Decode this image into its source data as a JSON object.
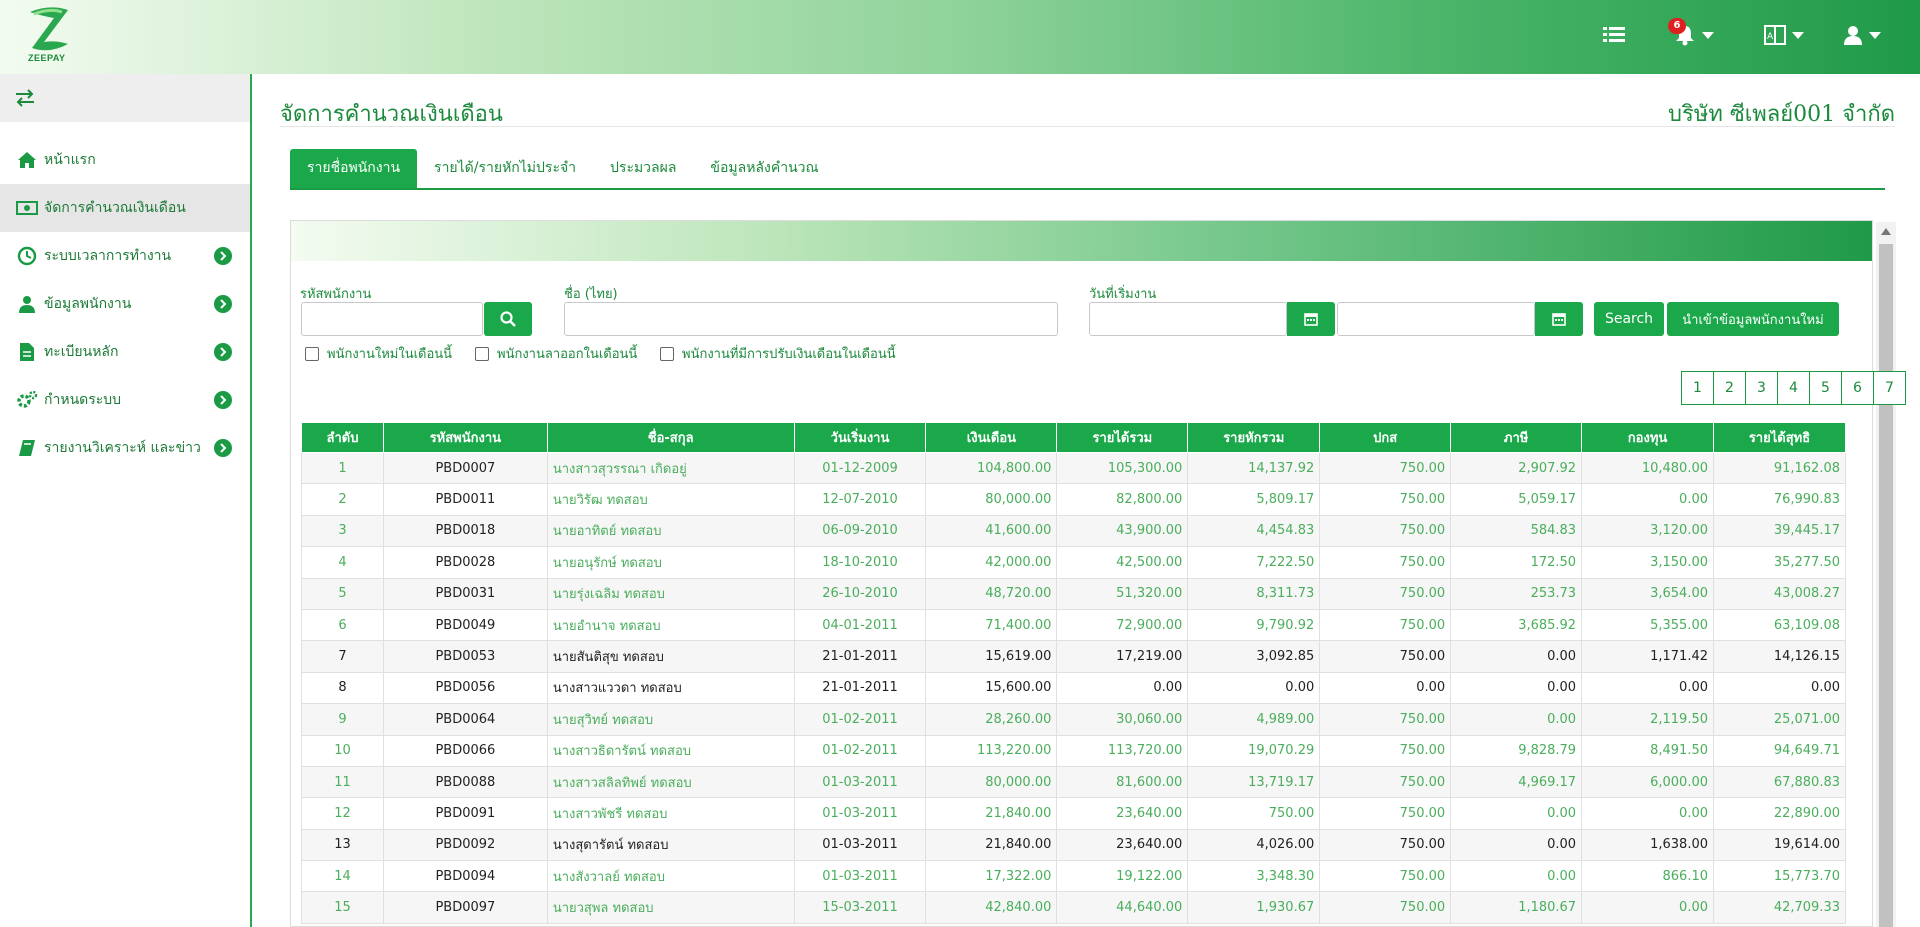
{
  "header": {
    "logo_text": "ZEEPAY",
    "notification_count": "6",
    "icons": [
      "list-icon",
      "bell-icon",
      "language-icon",
      "user-icon"
    ]
  },
  "sidebar": {
    "items": [
      {
        "label": "หน้าแรก",
        "icon": "home-icon",
        "has_arrow": false
      },
      {
        "label": "จัดการคำนวณเงินเดือน",
        "icon": "money-icon",
        "has_arrow": false,
        "active": true
      },
      {
        "label": "ระบบเวลาการทำงาน",
        "icon": "clock-icon",
        "has_arrow": true
      },
      {
        "label": "ข้อมูลพนักงาน",
        "icon": "user-icon",
        "has_arrow": true
      },
      {
        "label": "ทะเบียนหลัก",
        "icon": "file-icon",
        "has_arrow": true
      },
      {
        "label": "กำหนดระบบ",
        "icon": "gears-icon",
        "has_arrow": true
      },
      {
        "label": "รายงานวิเคราะห์ และข่าว",
        "icon": "book-icon",
        "has_arrow": true
      }
    ]
  },
  "page": {
    "title": "จัดการคำนวณเงินเดือน",
    "company": "บริษัท ซีเพลย์001 จำกัด"
  },
  "tabs": [
    {
      "label": "รายชื่อพนักงาน",
      "active": true
    },
    {
      "label": "รายได้/รายหักไม่ประจำ"
    },
    {
      "label": "ประมวลผล"
    },
    {
      "label": "ข้อมูลหลังคำนวณ"
    }
  ],
  "filters": {
    "emp_code_label": "รหัสพนักงาน",
    "emp_code_value": "",
    "name_label": "ชื่อ (ไทย)",
    "name_value": "",
    "start_date_label": "วันที่เริ่มงาน",
    "date_from": "",
    "date_to": "",
    "search_button": "Search",
    "import_button": "นำเข้าข้อมูลพนักงานใหม่",
    "check_new": "พนักงานใหม่ในเดือนนี้",
    "check_resigned": "พนักงานลาออกในเดือนนี้",
    "check_adjusted": "พนักงานที่มีการปรับเงินเดือนในเดือนนี้"
  },
  "pagination": [
    "1",
    "2",
    "3",
    "4",
    "5",
    "6",
    "7"
  ],
  "table": {
    "columns": [
      "ลำดับ",
      "รหัสพนักงาน",
      "ชื่อ-สกุล",
      "วันเริ่มงาน",
      "เงินเดือน",
      "รายได้รวม",
      "รายหักรวม",
      "ปกส",
      "ภาษี",
      "กองทุน",
      "รายได้สุทธิ"
    ],
    "rows": [
      {
        "no": "1",
        "code": "PBD0007",
        "name": "นางสาวสุวรรณา เกิดอยู่",
        "start": "01-12-2009",
        "salary": "104,800.00",
        "income": "105,300.00",
        "deduct": "14,137.92",
        "sso": "750.00",
        "tax": "2,907.92",
        "fund": "10,480.00",
        "net": "91,162.08",
        "style": "g"
      },
      {
        "no": "2",
        "code": "PBD0011",
        "name": "นายวิรัฒ ทดสอบ",
        "start": "12-07-2010",
        "salary": "80,000.00",
        "income": "82,800.00",
        "deduct": "5,809.17",
        "sso": "750.00",
        "tax": "5,059.17",
        "fund": "0.00",
        "net": "76,990.83",
        "style": "g"
      },
      {
        "no": "3",
        "code": "PBD0018",
        "name": "นายอาทิตย์ ทดสอบ",
        "start": "06-09-2010",
        "salary": "41,600.00",
        "income": "43,900.00",
        "deduct": "4,454.83",
        "sso": "750.00",
        "tax": "584.83",
        "fund": "3,120.00",
        "net": "39,445.17",
        "style": "g"
      },
      {
        "no": "4",
        "code": "PBD0028",
        "name": "นายอนุรักษ์ ทดสอบ",
        "start": "18-10-2010",
        "salary": "42,000.00",
        "income": "42,500.00",
        "deduct": "7,222.50",
        "sso": "750.00",
        "tax": "172.50",
        "fund": "3,150.00",
        "net": "35,277.50",
        "style": "g"
      },
      {
        "no": "5",
        "code": "PBD0031",
        "name": "นายรุ่งเฉลิม ทดสอบ",
        "start": "26-10-2010",
        "salary": "48,720.00",
        "income": "51,320.00",
        "deduct": "8,311.73",
        "sso": "750.00",
        "tax": "253.73",
        "fund": "3,654.00",
        "net": "43,008.27",
        "style": "g"
      },
      {
        "no": "6",
        "code": "PBD0049",
        "name": "นายอำนาจ ทดสอบ",
        "start": "04-01-2011",
        "salary": "71,400.00",
        "income": "72,900.00",
        "deduct": "9,790.92",
        "sso": "750.00",
        "tax": "3,685.92",
        "fund": "5,355.00",
        "net": "63,109.08",
        "style": "g"
      },
      {
        "no": "7",
        "code": "PBD0053",
        "name": "นายสันติสุข ทดสอบ",
        "start": "21-01-2011",
        "salary": "15,619.00",
        "income": "17,219.00",
        "deduct": "3,092.85",
        "sso": "750.00",
        "tax": "0.00",
        "fund": "1,171.42",
        "net": "14,126.15",
        "style": "b"
      },
      {
        "no": "8",
        "code": "PBD0056",
        "name": "นางสาวแววดา ทดสอบ",
        "start": "21-01-2011",
        "salary": "15,600.00",
        "income": "0.00",
        "deduct": "0.00",
        "sso": "0.00",
        "tax": "0.00",
        "fund": "0.00",
        "net": "0.00",
        "style": "b"
      },
      {
        "no": "9",
        "code": "PBD0064",
        "name": "นายสุวิทย์ ทดสอบ",
        "start": "01-02-2011",
        "salary": "28,260.00",
        "income": "30,060.00",
        "deduct": "4,989.00",
        "sso": "750.00",
        "tax": "0.00",
        "fund": "2,119.50",
        "net": "25,071.00",
        "style": "g"
      },
      {
        "no": "10",
        "code": "PBD0066",
        "name": "นางสาวธิดารัตน์ ทดสอบ",
        "start": "01-02-2011",
        "salary": "113,220.00",
        "income": "113,720.00",
        "deduct": "19,070.29",
        "sso": "750.00",
        "tax": "9,828.79",
        "fund": "8,491.50",
        "net": "94,649.71",
        "style": "g"
      },
      {
        "no": "11",
        "code": "PBD0088",
        "name": "นางสาวสลิลทิพย์ ทดสอบ",
        "start": "01-03-2011",
        "salary": "80,000.00",
        "income": "81,600.00",
        "deduct": "13,719.17",
        "sso": "750.00",
        "tax": "4,969.17",
        "fund": "6,000.00",
        "net": "67,880.83",
        "style": "g"
      },
      {
        "no": "12",
        "code": "PBD0091",
        "name": "นางสาวพัชรี ทดสอบ",
        "start": "01-03-2011",
        "salary": "21,840.00",
        "income": "23,640.00",
        "deduct": "750.00",
        "sso": "750.00",
        "tax": "0.00",
        "fund": "0.00",
        "net": "22,890.00",
        "style": "g"
      },
      {
        "no": "13",
        "code": "PBD0092",
        "name": "นางสุดารัตน์ ทดสอบ",
        "start": "01-03-2011",
        "salary": "21,840.00",
        "income": "23,640.00",
        "deduct": "4,026.00",
        "sso": "750.00",
        "tax": "0.00",
        "fund": "1,638.00",
        "net": "19,614.00",
        "style": "b"
      },
      {
        "no": "14",
        "code": "PBD0094",
        "name": "นางสังวาลย์ ทดสอบ",
        "start": "01-03-2011",
        "salary": "17,322.00",
        "income": "19,122.00",
        "deduct": "3,348.30",
        "sso": "750.00",
        "tax": "0.00",
        "fund": "866.10",
        "net": "15,773.70",
        "style": "g"
      },
      {
        "no": "15",
        "code": "PBD0097",
        "name": "นายวสุพล ทดสอบ",
        "start": "15-03-2011",
        "salary": "42,840.00",
        "income": "44,640.00",
        "deduct": "1,930.67",
        "sso": "750.00",
        "tax": "1,180.67",
        "fund": "0.00",
        "net": "42,709.33",
        "style": "g"
      }
    ]
  },
  "colors": {
    "brand": "#1aa84a",
    "text_green": "#1c8a3c",
    "link_green": "#4aae5c"
  }
}
